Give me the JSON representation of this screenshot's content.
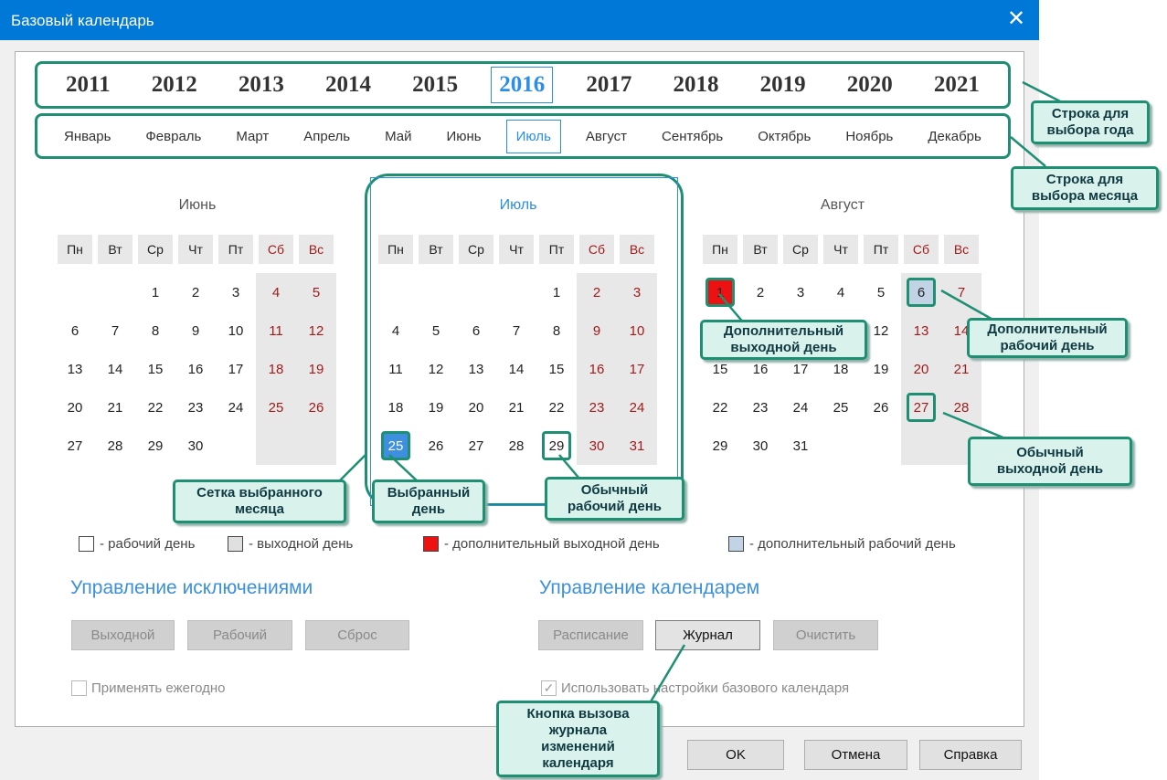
{
  "window": {
    "title": "Базовый календарь"
  },
  "years": [
    "2011",
    "2012",
    "2013",
    "2014",
    "2015",
    "2016",
    "2017",
    "2018",
    "2019",
    "2020",
    "2021"
  ],
  "selected_year": "2016",
  "months": [
    "Январь",
    "Февраль",
    "Март",
    "Апрель",
    "Май",
    "Июнь",
    "Июль",
    "Август",
    "Сентябрь",
    "Октябрь",
    "Ноябрь",
    "Декабрь"
  ],
  "selected_month": "Июль",
  "weekdays": [
    "Пн",
    "Вт",
    "Ср",
    "Чт",
    "Пт",
    "Сб",
    "Вс"
  ],
  "calendars": [
    {
      "name": "Июнь",
      "offset": 2,
      "days": 30,
      "active": false
    },
    {
      "name": "Июль",
      "offset": 4,
      "days": 31,
      "active": true,
      "selected_day": 25,
      "outlined_days": [
        29
      ]
    },
    {
      "name": "Август",
      "offset": 0,
      "days": 31,
      "active": false,
      "extra_off_days": [
        1
      ],
      "extra_work_days": [
        6
      ],
      "outlined_days": [
        27
      ]
    }
  ],
  "legend": {
    "work": "- рабочий день",
    "off": "- выходной день",
    "extra_off": "- дополнительный выходной день",
    "extra_work": "- дополнительный рабочий день"
  },
  "exceptions": {
    "title": "Управление исключениями",
    "btn_off": "Выходной",
    "btn_work": "Рабочий",
    "btn_reset": "Сброс",
    "yearly_label": "Применять ежегодно"
  },
  "calendar_mgmt": {
    "title": "Управление календарем",
    "btn_schedule": "Расписание",
    "btn_log": "Журнал",
    "btn_clear": "Очистить",
    "use_base_label": "Использовать настройки базового календаря",
    "use_base_checked": true
  },
  "dialog_buttons": {
    "ok": "OK",
    "cancel": "Отмена",
    "help": "Справка"
  },
  "callouts": {
    "year_row": "Строка для\nвыбора года",
    "month_row": "Строка для\nвыбора месяца",
    "grid": "Сетка выбранного\nмесяца",
    "selected_day": "Выбранный\nдень",
    "workday": "Обычный\nрабочий день",
    "extra_off": "Дополнительный\nвыходной день",
    "extra_work": "Дополнительный\nрабочий день",
    "weekend": "Обычный\nвыходной день",
    "log_button": "Кнопка вызова\nжурнала\nизменений\nкалендаря"
  },
  "colors": {
    "accent": "#2b8ee8",
    "callout_border": "#1e8f72",
    "extra_off": "#ee1111",
    "extra_work": "#c2d3e6",
    "weekend": "#a21b1b"
  }
}
